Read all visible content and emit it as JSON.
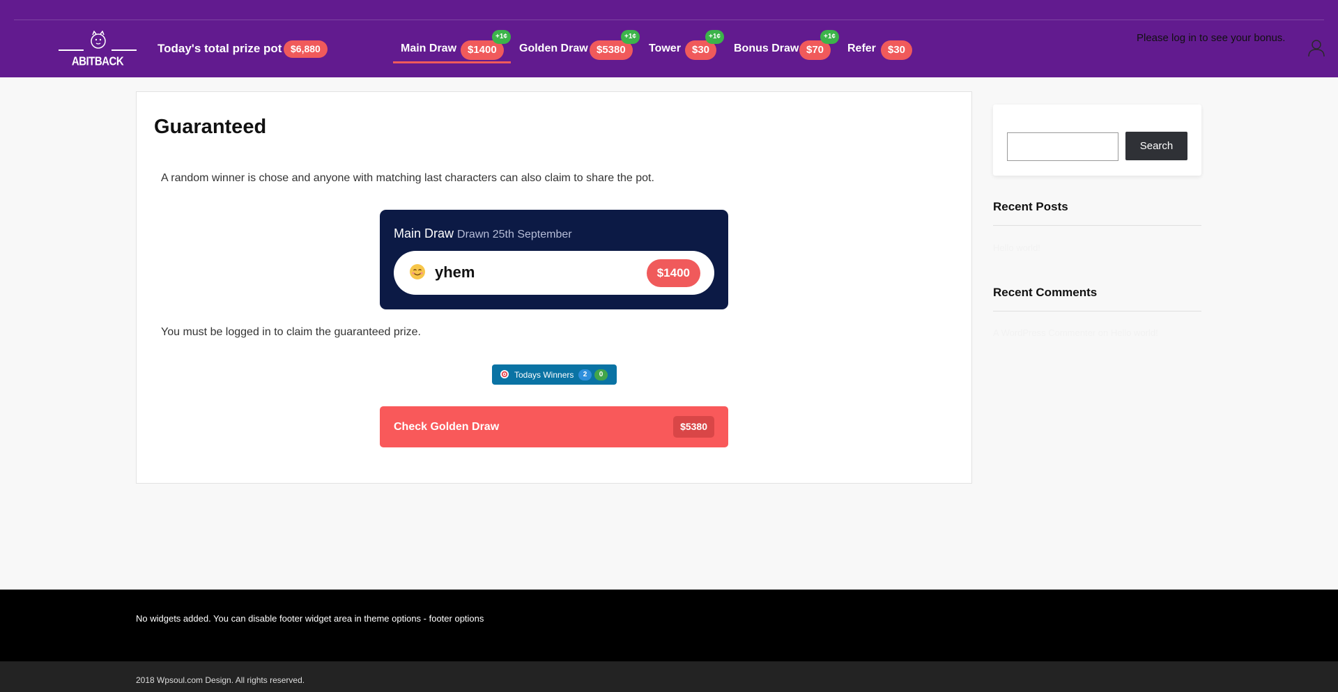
{
  "header": {
    "logo_text": "ABITBACK",
    "pot_label": "Today's total prize pot",
    "pot_value": "$6,880",
    "login_message": "Please log in to see your bonus."
  },
  "nav": [
    {
      "label": "Main Draw",
      "amount": "$1400",
      "bonus": "+1¢"
    },
    {
      "label": "Golden Draw",
      "amount": "$5380",
      "bonus": "+1¢"
    },
    {
      "label": "Tower",
      "amount": "$30",
      "bonus": "+1¢"
    },
    {
      "label": "Bonus Draw",
      "amount": "$70",
      "bonus": "+1¢"
    },
    {
      "label": "Refer",
      "amount": "$30"
    }
  ],
  "main": {
    "title": "Guaranteed",
    "intro": "A random winner is chose and anyone with matching last characters can also claim to share the pot.",
    "draw_card": {
      "title": "Main Draw",
      "subtitle": "Drawn 25th September",
      "winner_name": "yhem",
      "winner_amount": "$1400"
    },
    "claim_message": "You must be logged in to claim the guaranteed prize.",
    "todays_winners": {
      "label": "Todays Winners",
      "count_a": "2",
      "count_b": "0"
    },
    "golden_button": {
      "label": "Check Golden Draw",
      "amount": "$5380"
    }
  },
  "sidebar": {
    "search_button": "Search",
    "recent_posts_title": "Recent Posts",
    "recent_posts_item": "Hello world!",
    "recent_comments_title": "Recent Comments",
    "recent_comments_item": "A WordPress Commenter on Hello world!"
  },
  "footer": {
    "text": "No widgets added. You can disable footer widget area in theme options - footer options",
    "copyright": "2018 Wpsoul.com Design. All rights reserved."
  },
  "colors": {
    "header_bg": "#621b8f",
    "accent_red": "#f05a5b",
    "bonus_green": "#3cb34a",
    "draw_card_bg": "#0c1a45",
    "winners_button_bg": "#0a73a4"
  }
}
